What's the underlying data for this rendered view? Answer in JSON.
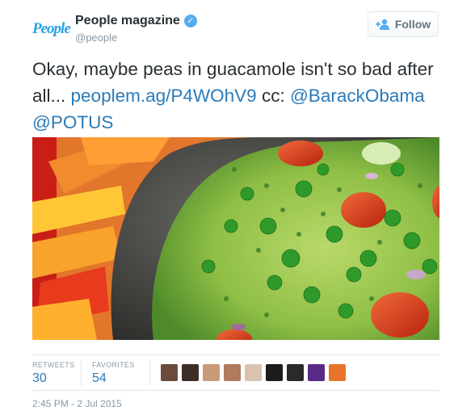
{
  "account": {
    "logo_text": "People",
    "display_name": "People magazine",
    "handle": "@people",
    "verified_mark": "✓"
  },
  "follow": {
    "label": "Follow",
    "icon": "add-user-icon"
  },
  "tweet": {
    "text_main": "Okay, maybe peas in guacamole isn't so bad after all...",
    "link": "peoplem.ag/P4WOhV9",
    "cc": "cc:",
    "mention_1": "@BarackObama",
    "mention_2": "@POTUS"
  },
  "stats": {
    "retweets_label": "RETWEETS",
    "retweets_count": "30",
    "favorites_label": "FAVORITES",
    "favorites_count": "54",
    "avatar_colors": [
      "#6b4a3a",
      "#3d2d26",
      "#c89a78",
      "#b07a5c",
      "#d9c3b0",
      "#1c1c1c",
      "#2a2a2a",
      "#5a2a86",
      "#e8742c"
    ]
  },
  "timestamp": "2:45 PM - 2 Jul 2015",
  "colors": {
    "link": "#2b7bb9",
    "logo": "#2aa3e0",
    "verified": "#55acee"
  }
}
